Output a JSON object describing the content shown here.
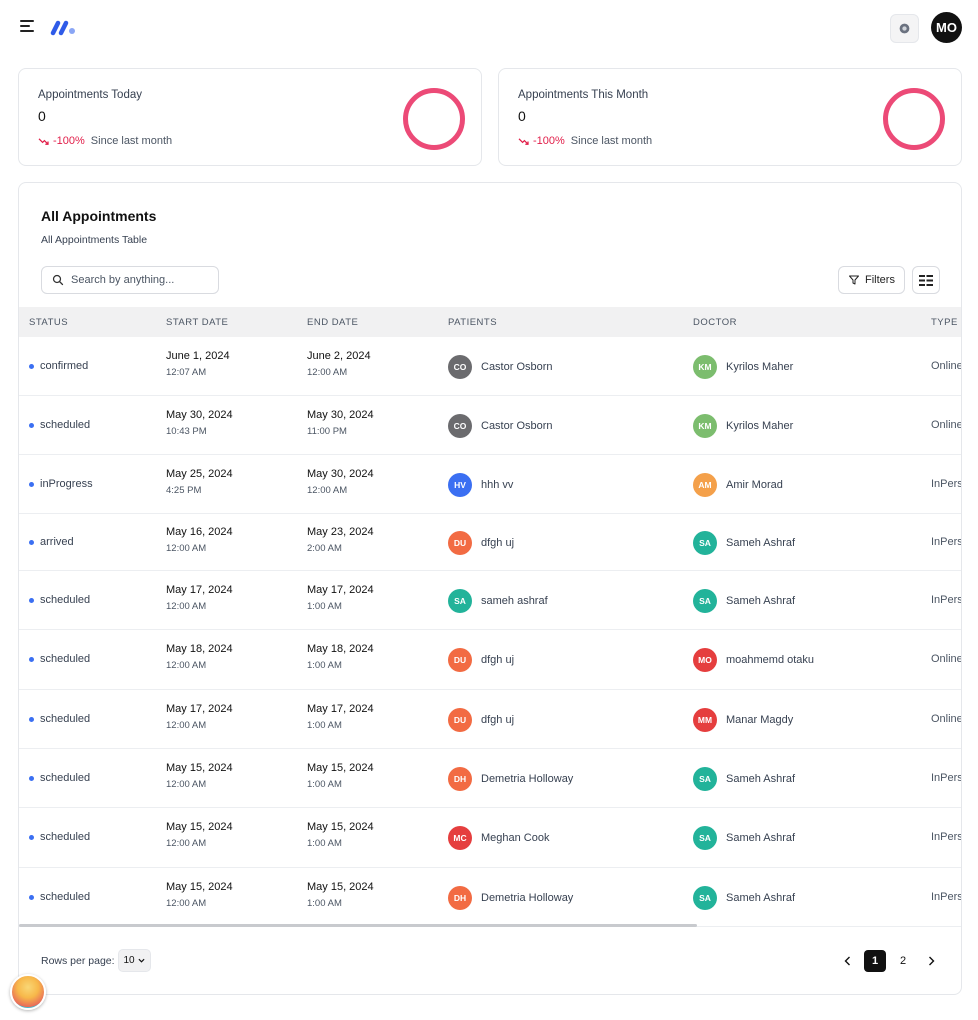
{
  "header": {
    "user_initials": "MO"
  },
  "stats": [
    {
      "title": "Appointments Today",
      "value": "0",
      "change": "-100%",
      "since": "Since last month"
    },
    {
      "title": "Appointments This Month",
      "value": "0",
      "change": "-100%",
      "since": "Since last month"
    }
  ],
  "colors": {
    "accent_ring": "#ec4a77",
    "negative": "#e11d48",
    "status_dot": "#3b6ff2"
  },
  "table": {
    "title": "All Appointments",
    "subtitle": "All Appointments Table",
    "search_placeholder": "Search by anything...",
    "filters_label": "Filters",
    "columns": [
      "STATUS",
      "START DATE",
      "END DATE",
      "PATIENTS",
      "DOCTOR",
      "TYPE"
    ],
    "rows": [
      {
        "status": "confirmed",
        "start_date": "June 1, 2024",
        "start_time": "12:07 AM",
        "end_date": "June 2, 2024",
        "end_time": "12:00 AM",
        "patient_initials": "CO",
        "patient": "Castor Osborn",
        "patient_color": "#6b6b6e",
        "doctor_initials": "KM",
        "doctor": "Kyrilos Maher",
        "doctor_color": "#7cbd6e",
        "type": "Online"
      },
      {
        "status": "scheduled",
        "start_date": "May 30, 2024",
        "start_time": "10:43 PM",
        "end_date": "May 30, 2024",
        "end_time": "11:00 PM",
        "patient_initials": "CO",
        "patient": "Castor Osborn",
        "patient_color": "#6b6b6e",
        "doctor_initials": "KM",
        "doctor": "Kyrilos Maher",
        "doctor_color": "#7cbd6e",
        "type": "Online"
      },
      {
        "status": "inProgress",
        "start_date": "May 25, 2024",
        "start_time": "4:25 PM",
        "end_date": "May 30, 2024",
        "end_time": "12:00 AM",
        "patient_initials": "HV",
        "patient": "hhh vv",
        "patient_color": "#3b6ff2",
        "doctor_initials": "AM",
        "doctor": "Amir Morad",
        "doctor_color": "#f4a04a",
        "type": "InPerson"
      },
      {
        "status": "arrived",
        "start_date": "May 16, 2024",
        "start_time": "12:00 AM",
        "end_date": "May 23, 2024",
        "end_time": "2:00 AM",
        "patient_initials": "DU",
        "patient": "dfgh uj",
        "patient_color": "#f26b43",
        "doctor_initials": "SA",
        "doctor": "Sameh Ashraf",
        "doctor_color": "#22b39a",
        "type": "InPerson"
      },
      {
        "status": "scheduled",
        "start_date": "May 17, 2024",
        "start_time": "12:00 AM",
        "end_date": "May 17, 2024",
        "end_time": "1:00 AM",
        "patient_initials": "SA",
        "patient": "sameh ashraf",
        "patient_color": "#22b39a",
        "doctor_initials": "SA",
        "doctor": "Sameh Ashraf",
        "doctor_color": "#22b39a",
        "type": "InPerson"
      },
      {
        "status": "scheduled",
        "start_date": "May 18, 2024",
        "start_time": "12:00 AM",
        "end_date": "May 18, 2024",
        "end_time": "1:00 AM",
        "patient_initials": "DU",
        "patient": "dfgh uj",
        "patient_color": "#f26b43",
        "doctor_initials": "MO",
        "doctor": "moahmemd otaku",
        "doctor_color": "#e53e3e",
        "type": "Online"
      },
      {
        "status": "scheduled",
        "start_date": "May 17, 2024",
        "start_time": "12:00 AM",
        "end_date": "May 17, 2024",
        "end_time": "1:00 AM",
        "patient_initials": "DU",
        "patient": "dfgh uj",
        "patient_color": "#f26b43",
        "doctor_initials": "MM",
        "doctor": "Manar Magdy",
        "doctor_color": "#e53e3e",
        "type": "Online"
      },
      {
        "status": "scheduled",
        "start_date": "May 15, 2024",
        "start_time": "12:00 AM",
        "end_date": "May 15, 2024",
        "end_time": "1:00 AM",
        "patient_initials": "DH",
        "patient": "Demetria Holloway",
        "patient_color": "#f26b43",
        "doctor_initials": "SA",
        "doctor": "Sameh Ashraf",
        "doctor_color": "#22b39a",
        "type": "InPerson"
      },
      {
        "status": "scheduled",
        "start_date": "May 15, 2024",
        "start_time": "12:00 AM",
        "end_date": "May 15, 2024",
        "end_time": "1:00 AM",
        "patient_initials": "MC",
        "patient": "Meghan Cook",
        "patient_color": "#e53e3e",
        "doctor_initials": "SA",
        "doctor": "Sameh Ashraf",
        "doctor_color": "#22b39a",
        "type": "InPerson"
      },
      {
        "status": "scheduled",
        "start_date": "May 15, 2024",
        "start_time": "12:00 AM",
        "end_date": "May 15, 2024",
        "end_time": "1:00 AM",
        "patient_initials": "DH",
        "patient": "Demetria Holloway",
        "patient_color": "#f26b43",
        "doctor_initials": "SA",
        "doctor": "Sameh Ashraf",
        "doctor_color": "#22b39a",
        "type": "InPerson"
      }
    ]
  },
  "footer": {
    "rows_per_page_label": "Rows per page:",
    "rows_per_page_value": "10",
    "pages": [
      "1",
      "2"
    ],
    "current_page": "1"
  }
}
